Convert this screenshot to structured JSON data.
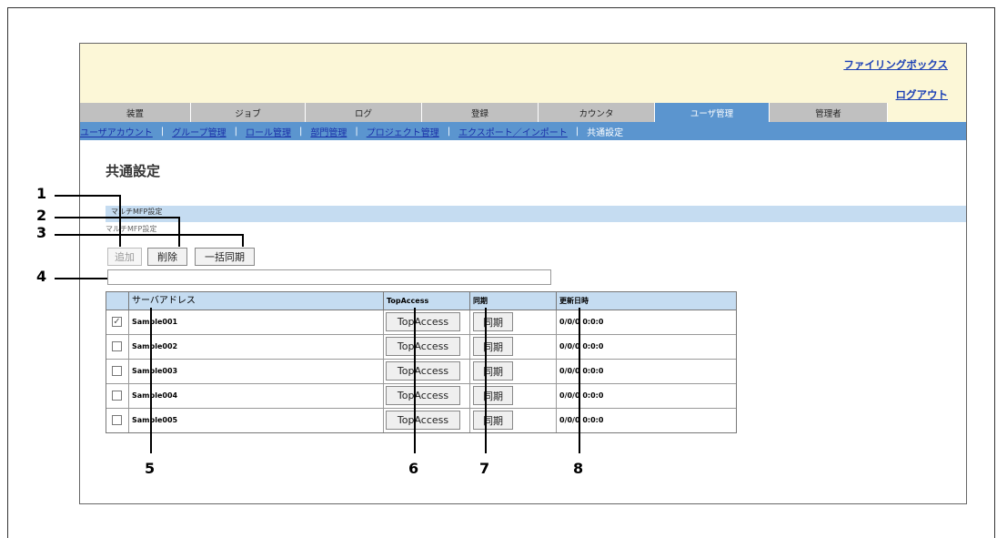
{
  "header": {
    "filing_box": "ファイリングボックス",
    "logout": "ログアウト"
  },
  "tabs": [
    "装置",
    "ジョブ",
    "ログ",
    "登録",
    "カウンタ",
    "ユーザ管理",
    "管理者"
  ],
  "active_tab": "ユーザ管理",
  "subnav": {
    "items": [
      "ユーザアカウント",
      "グループ管理",
      "ロール管理",
      "部門管理",
      "プロジェクト管理",
      "エクスポート／インポート"
    ],
    "current": "共通設定"
  },
  "page": {
    "title": "共通設定",
    "section": "マルチMFP設定",
    "section_sub": "マルチMFP設定"
  },
  "toolbar": {
    "add": "追加",
    "delete": "削除",
    "bulk_sync": "一括同期"
  },
  "table": {
    "columns": [
      "サーバアドレス",
      "TopAccess",
      "同期",
      "更新日時"
    ],
    "row_button_topaccess": "TopAccess",
    "row_button_sync": "同期",
    "rows": [
      {
        "server": "Sample001",
        "updated": "0/0/0 0:0:0",
        "checked": true
      },
      {
        "server": "Sample002",
        "updated": "0/0/0 0:0:0",
        "checked": false
      },
      {
        "server": "Sample003",
        "updated": "0/0/0 0:0:0",
        "checked": false
      },
      {
        "server": "Sample004",
        "updated": "0/0/0 0:0:0",
        "checked": false
      },
      {
        "server": "Sample005",
        "updated": "0/0/0 0:0:0",
        "checked": false
      }
    ]
  },
  "callouts": [
    "1",
    "2",
    "3",
    "4",
    "5",
    "6",
    "7",
    "8"
  ],
  "colors": {
    "tab_bar": "#c0c0c0",
    "accent_blue": "#5b95cf",
    "header_bg": "#fcf7d7",
    "table_header": "#c5dcf1",
    "link": "#1a3fb5"
  }
}
